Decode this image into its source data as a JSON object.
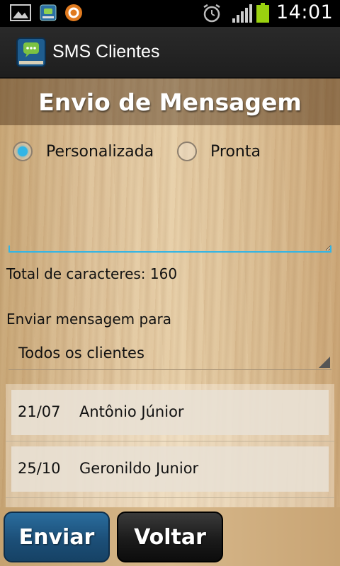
{
  "status_bar": {
    "time": "14:01",
    "icons": [
      "gallery-icon",
      "app-notification-icon",
      "sync-icon",
      "alarm-icon",
      "signal-icon",
      "battery-icon"
    ],
    "battery_color": "#9ad10f"
  },
  "action_bar": {
    "title": "SMS Clientes"
  },
  "screen": {
    "title": "Envio de Mensagem"
  },
  "message_type": {
    "options": [
      {
        "label": "Personalizada",
        "checked": true
      },
      {
        "label": "Pronta",
        "checked": false
      }
    ]
  },
  "message": {
    "value": "",
    "char_count_label": "Total de caracteres: 160"
  },
  "recipients": {
    "label": "Enviar mensagem para",
    "selected": "Todos os clientes"
  },
  "clients": [
    {
      "date": "21/07",
      "name": "Antônio Júnior"
    },
    {
      "date": "25/10",
      "name": "Geronildo Junior"
    }
  ],
  "buttons": {
    "send": "Enviar",
    "back": "Voltar"
  },
  "colors": {
    "accent": "#33b5e5",
    "send_button": "#1c4f78",
    "back_button": "#1b1b1b"
  }
}
